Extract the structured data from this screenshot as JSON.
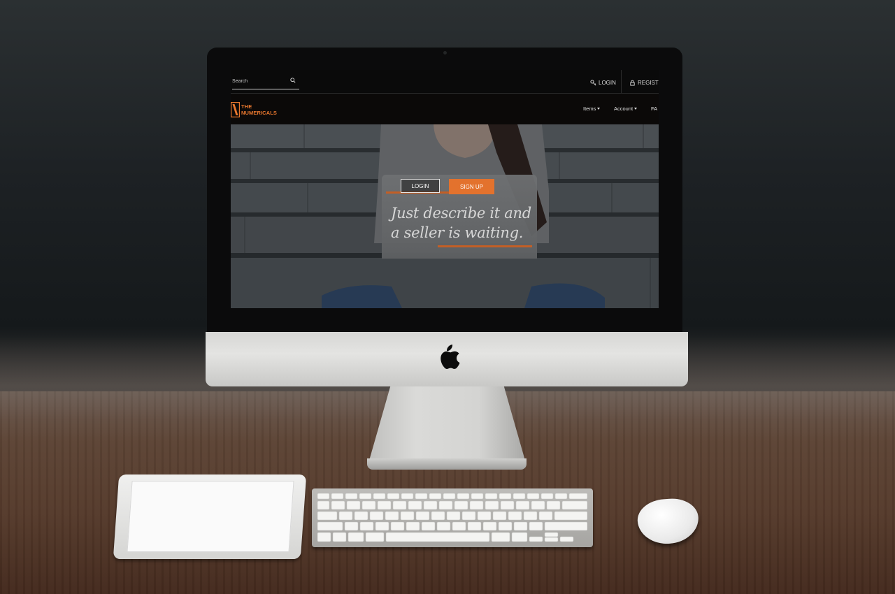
{
  "topbar": {
    "search_placeholder": "Search",
    "login_label": "LOGIN",
    "register_label": "REGIST"
  },
  "brand": {
    "line1": "THE",
    "line2": "NUMERICALS",
    "color": "#e8772e"
  },
  "nav": {
    "items": [
      {
        "label": "Items"
      },
      {
        "label": "Account"
      },
      {
        "label": "FA"
      }
    ]
  },
  "hero": {
    "login_button": "LOGIN",
    "signup_button": "SIGN UP",
    "tagline": "Just describe it and a seller is waiting.",
    "accent_color": "#e3722d"
  },
  "icons": {
    "search": "search-icon",
    "login": "key-icon",
    "register": "user-icon",
    "hardware_logo": "apple-logo-icon"
  }
}
